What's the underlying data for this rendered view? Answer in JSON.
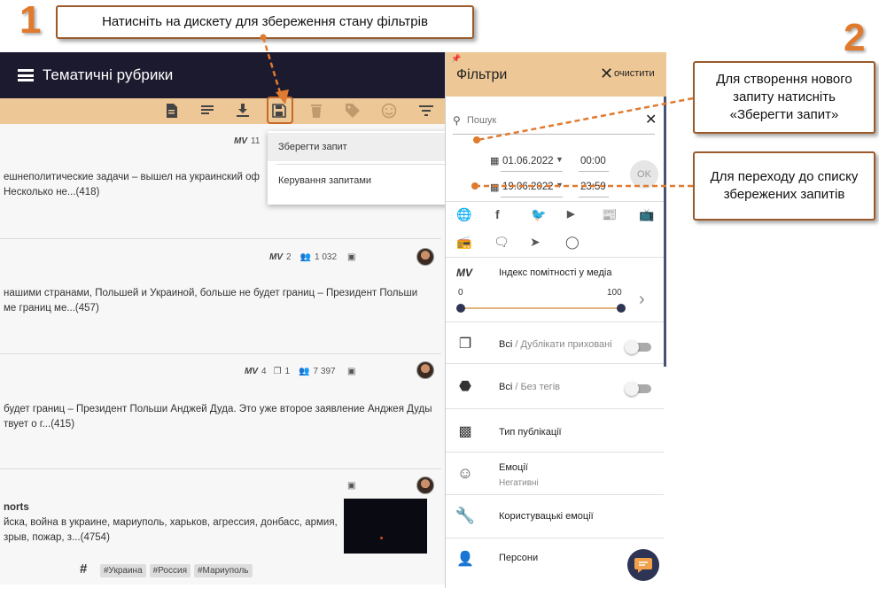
{
  "annotations": {
    "step1": "1",
    "step2": "2",
    "callout_top": "Натисніть на дискету для збереження стану фільтрів",
    "callout_save": "Для створення нового запиту натисніть «Зберегти запит»",
    "callout_list": "Для переходу до списку збережених запитів",
    "accent_color": "#e07a2e"
  },
  "header": {
    "title": "Тематичні рубрики"
  },
  "dropdown": {
    "save_query": "Зберегти запит",
    "manage_queries": "Керування запитами"
  },
  "feed": {
    "cards": [
      {
        "mv": "MV",
        "mv_value": "11",
        "line1": "ешнеполитические задачи – вышел на украинский оф",
        "line2": "Несколько не...(418)"
      },
      {
        "mv": "MV",
        "mv_value": "2",
        "people": "1 032",
        "line1": "нашими странами, Польшей и Украиной, больше не будет границ – Президент Польши",
        "line2": "ме границ ме...(457)"
      },
      {
        "mv": "MV",
        "mv_value": "4",
        "copies": "1",
        "people": "7 397",
        "line1": "будет границ – Президент Польши Анджей Дуда. Это уже второе заявление Анджея Дуды",
        "line2": "твует о г...(415)"
      },
      {
        "title": "norts",
        "line1": "йска, война в украине, мариуполь, харьков, агрессия, донбасс, армия,",
        "line2": "зрыв, пожар, з...(4754)",
        "hash": "#",
        "tags": [
          "#Украина",
          "#Россия",
          "#Мариуполь"
        ]
      }
    ]
  },
  "filters": {
    "title": "Фільтри",
    "clear": "очистити",
    "search_placeholder": "Пошук",
    "date_from": "01.06.2022",
    "time_from": "00:00",
    "date_to": "19.06.2022",
    "time_to": "23:59",
    "ok": "OK",
    "mv_label": "MV",
    "media_index": "Індекс помітності у медіа",
    "range_min": "0",
    "range_max": "100",
    "duplicates_all": "Всі",
    "duplicates_sep": " / ",
    "duplicates_hidden": "Дублікати приховані",
    "tags_all": "Всі",
    "tags_sep": " / ",
    "tags_none": "Без тегів",
    "pub_type": "Тип публікації",
    "emotions": "Емоції",
    "emotions_value": "Негативні",
    "user_emotions": "Користувацькі емоції",
    "persons": "Персони"
  }
}
